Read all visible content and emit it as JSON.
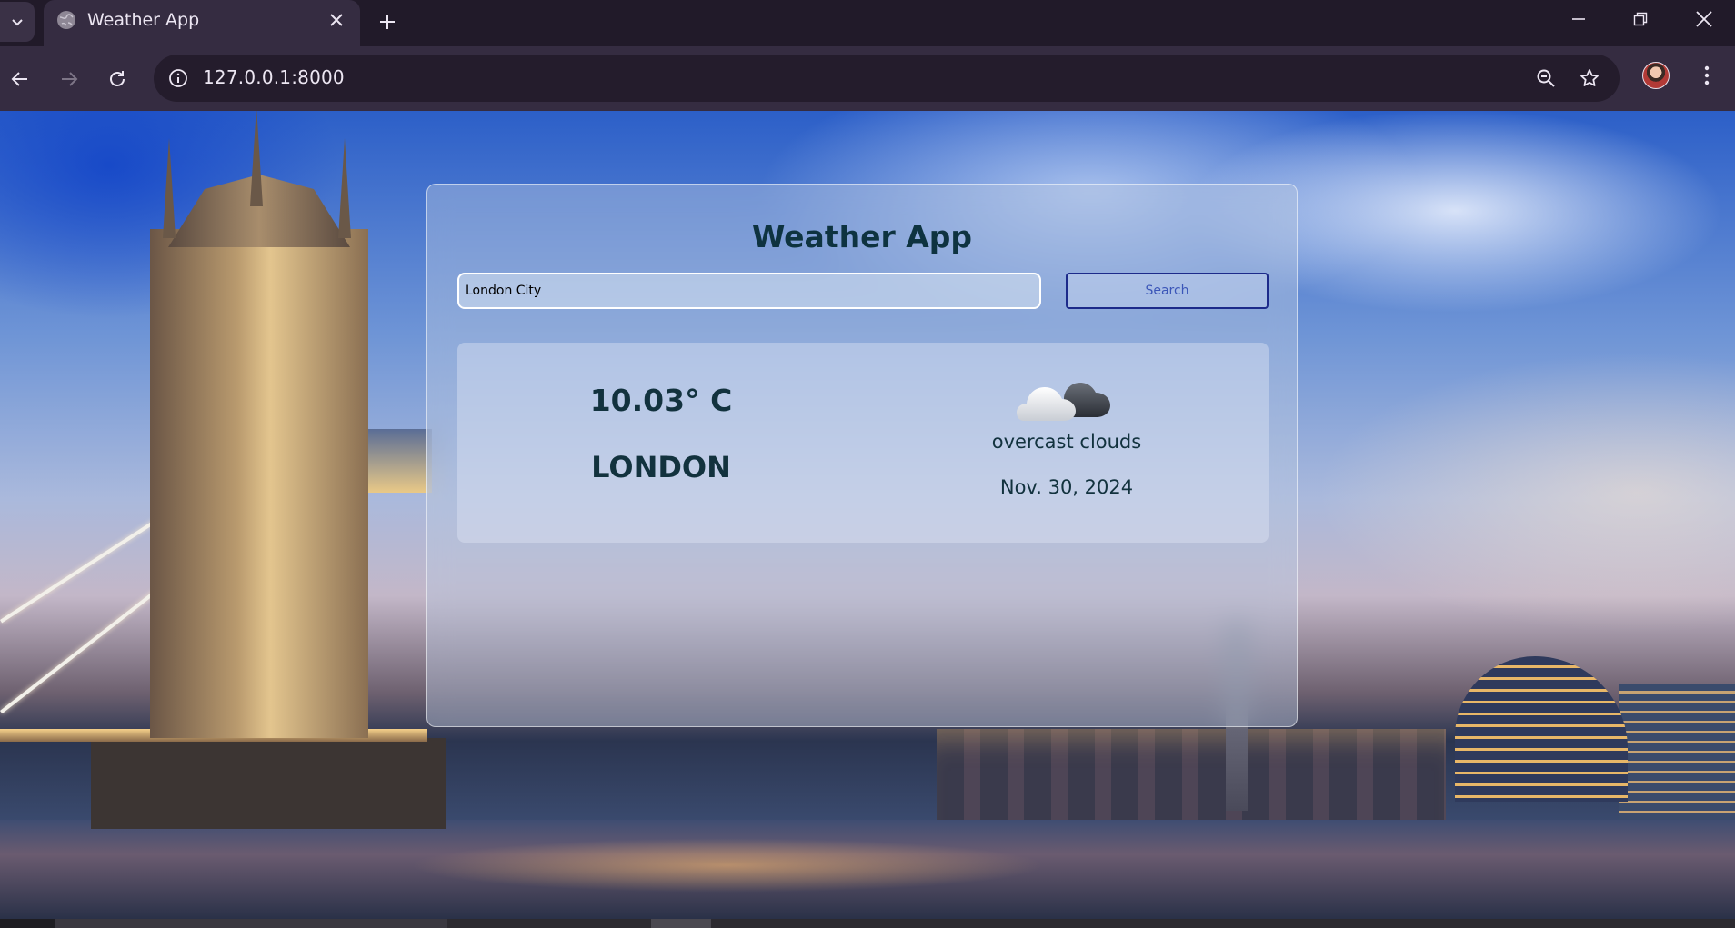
{
  "browser": {
    "tab_title": "Weather App",
    "url": "127.0.0.1:8000",
    "icons": {
      "tab_list": "chevron-down-icon",
      "favicon": "globe-icon",
      "tab_close": "close-icon",
      "new_tab": "plus-icon",
      "minimize": "minimize-icon",
      "restore": "restore-icon",
      "close_window": "close-icon",
      "back": "arrow-left-icon",
      "forward": "arrow-right-icon",
      "reload": "reload-icon",
      "site_info": "info-icon",
      "zoom": "zoom-out-icon",
      "bookmark": "star-icon",
      "menu": "kebab-menu-icon"
    },
    "colors": {
      "tabbar": "#211a29",
      "toolbar": "#352c41",
      "omnibox": "#241c2c"
    }
  },
  "app": {
    "title": "Weather App",
    "search": {
      "value": "London City",
      "button_label": "Search"
    },
    "result": {
      "temperature": "10.03° C",
      "city": "LONDON",
      "condition": "overcast clouds",
      "date": "Nov. 30, 2024",
      "icon": "overcast-clouds-icon"
    },
    "colors": {
      "text": "#12323e",
      "button_border": "#1c2a8a",
      "button_text": "#3b56b8"
    }
  }
}
